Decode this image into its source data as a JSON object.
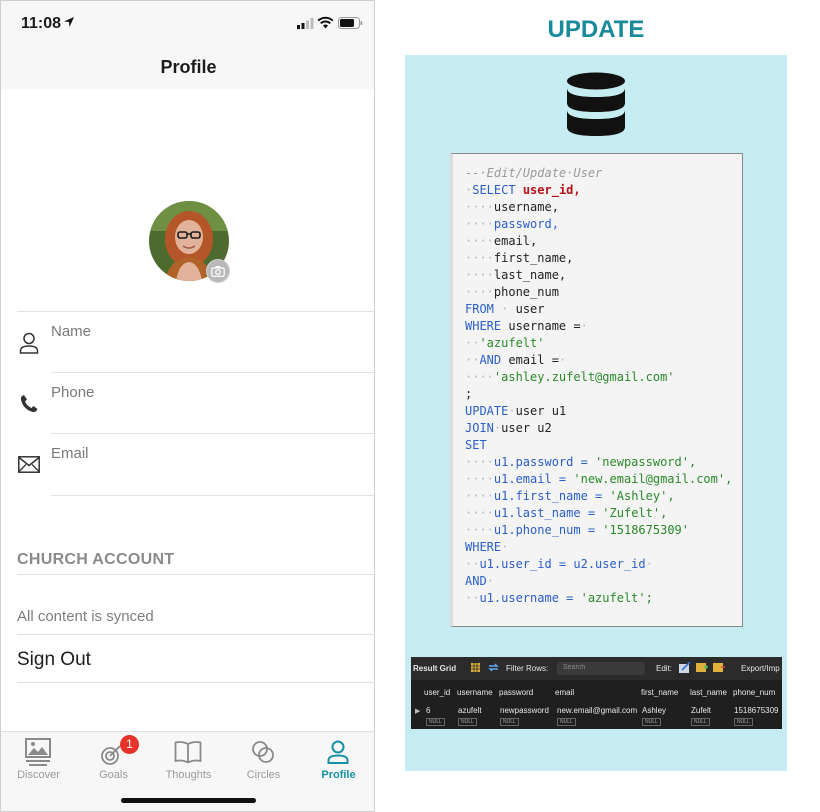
{
  "status_bar": {
    "time": "11:08"
  },
  "nav": {
    "title": "Profile"
  },
  "profile": {
    "fields": [
      {
        "label": "Name",
        "icon": "person-icon"
      },
      {
        "label": "Phone",
        "icon": "phone-icon"
      },
      {
        "label": "Email",
        "icon": "mail-icon"
      }
    ],
    "section_title": "CHURCH ACCOUNT",
    "sync_status": "All content is synced",
    "sign_out_label": "Sign Out"
  },
  "tabs": [
    {
      "label": "Discover",
      "icon": "discover-icon",
      "active": false
    },
    {
      "label": "Goals",
      "icon": "goals-icon",
      "badge": "1",
      "active": false
    },
    {
      "label": "Thoughts",
      "icon": "book-icon",
      "active": false
    },
    {
      "label": "Circles",
      "icon": "circles-icon",
      "active": false
    },
    {
      "label": "Profile",
      "icon": "profile-icon",
      "active": true
    }
  ],
  "colors": {
    "accent": "#1592a6",
    "panel_bg": "#c5ecf1",
    "title": "#178a9b",
    "badge": "#e5332a"
  },
  "update_panel": {
    "title": "UPDATE",
    "sql": {
      "comment": "--·Edit/Update·User",
      "select": "SELECT",
      "user_id": "user_id,",
      "username": "username,",
      "password": "password,",
      "email": "email,",
      "first_name": "first_name,",
      "last_name": "last_name,",
      "phone_num": "phone_num",
      "from": "FROM",
      "user": "user",
      "where": "WHERE",
      "username_eq": "username =",
      "azufelt": "'azufelt'",
      "and": "AND",
      "email_eq": "email =",
      "email_val": "'ashley.zufelt@gmail.com'",
      "semicolon": ";",
      "update": "UPDATE",
      "user_u1": "user u1",
      "join": "JOIN",
      "user_u2": "user u2",
      "set": "SET",
      "set_password": "u1.password =",
      "set_password_val": "'newpassword',",
      "set_email": "u1.email =",
      "set_email_val": "'new.email@gmail.com',",
      "set_first": "u1.first_name =",
      "set_first_val": "'Ashley',",
      "set_last": "u1.last_name =",
      "set_last_val": "'Zufelt',",
      "set_phone": "u1.phone_num =",
      "set_phone_val": "'1518675309'",
      "where2": "WHERE",
      "join_cond": "u1.user_id = u2.user_id",
      "and2": "AND",
      "final_cond": "u1.username =",
      "final_val": "'azufelt';"
    },
    "result_grid": {
      "title": "Result Grid",
      "filter_label": "Filter Rows:",
      "search_placeholder": "Search",
      "edit_label": "Edit:",
      "export_label": "Export/Imp",
      "columns": [
        "user_id",
        "username",
        "password",
        "email",
        "first_name",
        "last_name",
        "phone_num"
      ],
      "row": [
        "6",
        "azufelt",
        "newpassword",
        "new.email@gmail.com",
        "Ashley",
        "Zufelt",
        "1518675309"
      ],
      "null_label": "NULL"
    }
  }
}
